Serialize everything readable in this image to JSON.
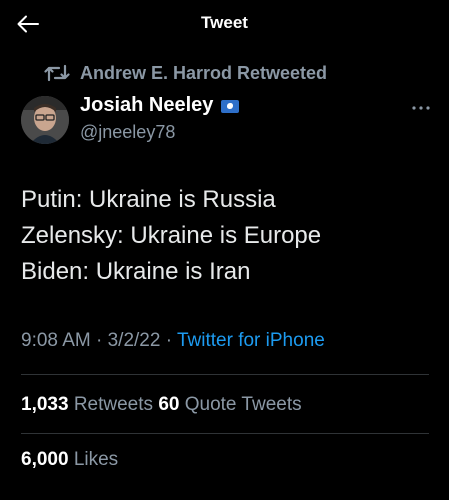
{
  "header": {
    "title": "Tweet",
    "back_icon": "arrow-left-icon"
  },
  "retweet": {
    "icon": "retweet-icon",
    "text": "Andrew E. Harrod Retweeted"
  },
  "author": {
    "name": "Josiah Neeley",
    "handle": "@jneeley78",
    "badge_icon": "flag-emoji-icon"
  },
  "tweet": {
    "lines": [
      "Putin: Ukraine is Russia",
      "Zelensky: Ukraine is Europe",
      "Biden: Ukraine is Iran"
    ]
  },
  "meta": {
    "time": "9:08 AM",
    "separator": "·",
    "date": "3/2/22",
    "source": "Twitter for iPhone"
  },
  "stats": {
    "retweets_count": "1,033",
    "retweets_label": "Retweets",
    "quotes_count": "60",
    "quotes_label": "Quote Tweets",
    "likes_count": "6,000",
    "likes_label": "Likes"
  },
  "colors": {
    "background": "#000000",
    "text_primary": "#e7e9ea",
    "text_secondary": "#8b98a5",
    "link": "#1d9bf0",
    "divider": "#2f3336"
  }
}
